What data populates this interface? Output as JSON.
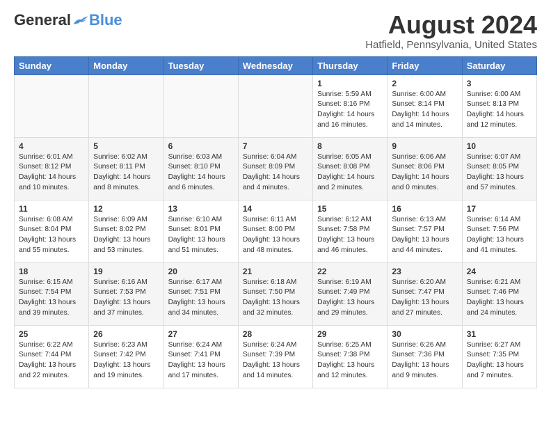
{
  "header": {
    "logo_general": "General",
    "logo_blue": "Blue",
    "month_title": "August 2024",
    "location": "Hatfield, Pennsylvania, United States"
  },
  "weekdays": [
    "Sunday",
    "Monday",
    "Tuesday",
    "Wednesday",
    "Thursday",
    "Friday",
    "Saturday"
  ],
  "weeks": [
    [
      {
        "day": "",
        "info": ""
      },
      {
        "day": "",
        "info": ""
      },
      {
        "day": "",
        "info": ""
      },
      {
        "day": "",
        "info": ""
      },
      {
        "day": "1",
        "info": "Sunrise: 5:59 AM\nSunset: 8:16 PM\nDaylight: 14 hours\nand 16 minutes."
      },
      {
        "day": "2",
        "info": "Sunrise: 6:00 AM\nSunset: 8:14 PM\nDaylight: 14 hours\nand 14 minutes."
      },
      {
        "day": "3",
        "info": "Sunrise: 6:00 AM\nSunset: 8:13 PM\nDaylight: 14 hours\nand 12 minutes."
      }
    ],
    [
      {
        "day": "4",
        "info": "Sunrise: 6:01 AM\nSunset: 8:12 PM\nDaylight: 14 hours\nand 10 minutes."
      },
      {
        "day": "5",
        "info": "Sunrise: 6:02 AM\nSunset: 8:11 PM\nDaylight: 14 hours\nand 8 minutes."
      },
      {
        "day": "6",
        "info": "Sunrise: 6:03 AM\nSunset: 8:10 PM\nDaylight: 14 hours\nand 6 minutes."
      },
      {
        "day": "7",
        "info": "Sunrise: 6:04 AM\nSunset: 8:09 PM\nDaylight: 14 hours\nand 4 minutes."
      },
      {
        "day": "8",
        "info": "Sunrise: 6:05 AM\nSunset: 8:08 PM\nDaylight: 14 hours\nand 2 minutes."
      },
      {
        "day": "9",
        "info": "Sunrise: 6:06 AM\nSunset: 8:06 PM\nDaylight: 14 hours\nand 0 minutes."
      },
      {
        "day": "10",
        "info": "Sunrise: 6:07 AM\nSunset: 8:05 PM\nDaylight: 13 hours\nand 57 minutes."
      }
    ],
    [
      {
        "day": "11",
        "info": "Sunrise: 6:08 AM\nSunset: 8:04 PM\nDaylight: 13 hours\nand 55 minutes."
      },
      {
        "day": "12",
        "info": "Sunrise: 6:09 AM\nSunset: 8:02 PM\nDaylight: 13 hours\nand 53 minutes."
      },
      {
        "day": "13",
        "info": "Sunrise: 6:10 AM\nSunset: 8:01 PM\nDaylight: 13 hours\nand 51 minutes."
      },
      {
        "day": "14",
        "info": "Sunrise: 6:11 AM\nSunset: 8:00 PM\nDaylight: 13 hours\nand 48 minutes."
      },
      {
        "day": "15",
        "info": "Sunrise: 6:12 AM\nSunset: 7:58 PM\nDaylight: 13 hours\nand 46 minutes."
      },
      {
        "day": "16",
        "info": "Sunrise: 6:13 AM\nSunset: 7:57 PM\nDaylight: 13 hours\nand 44 minutes."
      },
      {
        "day": "17",
        "info": "Sunrise: 6:14 AM\nSunset: 7:56 PM\nDaylight: 13 hours\nand 41 minutes."
      }
    ],
    [
      {
        "day": "18",
        "info": "Sunrise: 6:15 AM\nSunset: 7:54 PM\nDaylight: 13 hours\nand 39 minutes."
      },
      {
        "day": "19",
        "info": "Sunrise: 6:16 AM\nSunset: 7:53 PM\nDaylight: 13 hours\nand 37 minutes."
      },
      {
        "day": "20",
        "info": "Sunrise: 6:17 AM\nSunset: 7:51 PM\nDaylight: 13 hours\nand 34 minutes."
      },
      {
        "day": "21",
        "info": "Sunrise: 6:18 AM\nSunset: 7:50 PM\nDaylight: 13 hours\nand 32 minutes."
      },
      {
        "day": "22",
        "info": "Sunrise: 6:19 AM\nSunset: 7:49 PM\nDaylight: 13 hours\nand 29 minutes."
      },
      {
        "day": "23",
        "info": "Sunrise: 6:20 AM\nSunset: 7:47 PM\nDaylight: 13 hours\nand 27 minutes."
      },
      {
        "day": "24",
        "info": "Sunrise: 6:21 AM\nSunset: 7:46 PM\nDaylight: 13 hours\nand 24 minutes."
      }
    ],
    [
      {
        "day": "25",
        "info": "Sunrise: 6:22 AM\nSunset: 7:44 PM\nDaylight: 13 hours\nand 22 minutes."
      },
      {
        "day": "26",
        "info": "Sunrise: 6:23 AM\nSunset: 7:42 PM\nDaylight: 13 hours\nand 19 minutes."
      },
      {
        "day": "27",
        "info": "Sunrise: 6:24 AM\nSunset: 7:41 PM\nDaylight: 13 hours\nand 17 minutes."
      },
      {
        "day": "28",
        "info": "Sunrise: 6:24 AM\nSunset: 7:39 PM\nDaylight: 13 hours\nand 14 minutes."
      },
      {
        "day": "29",
        "info": "Sunrise: 6:25 AM\nSunset: 7:38 PM\nDaylight: 13 hours\nand 12 minutes."
      },
      {
        "day": "30",
        "info": "Sunrise: 6:26 AM\nSunset: 7:36 PM\nDaylight: 13 hours\nand 9 minutes."
      },
      {
        "day": "31",
        "info": "Sunrise: 6:27 AM\nSunset: 7:35 PM\nDaylight: 13 hours\nand 7 minutes."
      }
    ]
  ]
}
